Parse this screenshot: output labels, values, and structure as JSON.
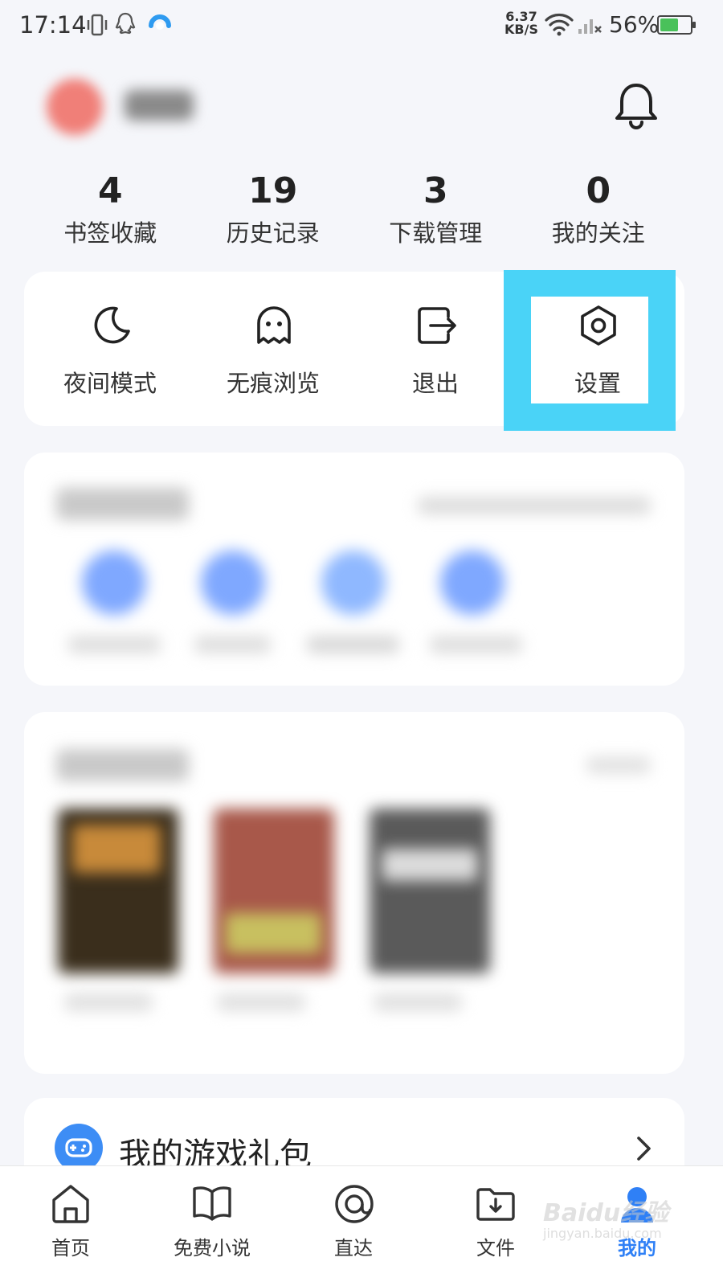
{
  "status_bar": {
    "time": "17:14",
    "net_speed_value": "6.37",
    "net_speed_unit": "KB/S",
    "battery": "56%",
    "battery_level": 0.56
  },
  "stats": [
    {
      "count": "4",
      "label": "书签收藏"
    },
    {
      "count": "19",
      "label": "历史记录"
    },
    {
      "count": "3",
      "label": "下载管理"
    },
    {
      "count": "0",
      "label": "我的关注"
    }
  ],
  "tools": [
    {
      "label": "夜间模式",
      "icon": "moon-icon"
    },
    {
      "label": "无痕浏览",
      "icon": "ghost-icon"
    },
    {
      "label": "退出",
      "icon": "logout-icon"
    },
    {
      "label": "设置",
      "icon": "settings-icon"
    }
  ],
  "highlight_color": "#4ad3f7",
  "gift": {
    "label": "我的游戏礼包"
  },
  "bottom_nav": [
    {
      "label": "首页",
      "icon": "home-icon",
      "active": false
    },
    {
      "label": "免费小说",
      "icon": "book-icon",
      "active": false
    },
    {
      "label": "直达",
      "icon": "direct-icon",
      "active": false
    },
    {
      "label": "文件",
      "icon": "folder-icon",
      "active": false
    },
    {
      "label": "我的",
      "icon": "user-icon",
      "active": true
    }
  ],
  "accent_color": "#2f80f6",
  "watermark": {
    "main": "Baidu经验",
    "sub": "jingyan.baidu.com"
  }
}
